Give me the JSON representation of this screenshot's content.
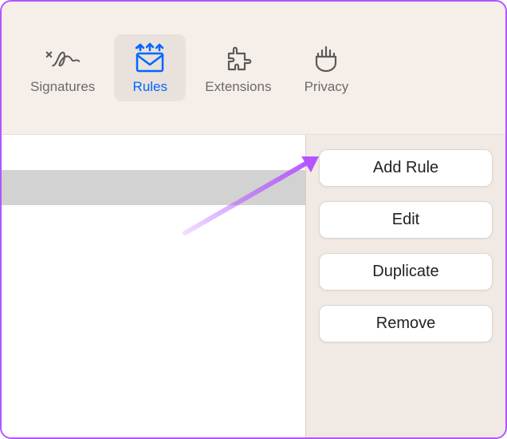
{
  "toolbar": {
    "items": [
      {
        "label": "Signatures",
        "icon": "signature-icon",
        "active": false
      },
      {
        "label": "Rules",
        "icon": "rules-icon",
        "active": true
      },
      {
        "label": "Extensions",
        "icon": "extensions-icon",
        "active": false
      },
      {
        "label": "Privacy",
        "icon": "privacy-icon",
        "active": false
      }
    ]
  },
  "buttons": {
    "add": "Add Rule",
    "edit": "Edit",
    "duplicate": "Duplicate",
    "remove": "Remove"
  },
  "annotation": {
    "arrow_color": "#b455ff"
  }
}
